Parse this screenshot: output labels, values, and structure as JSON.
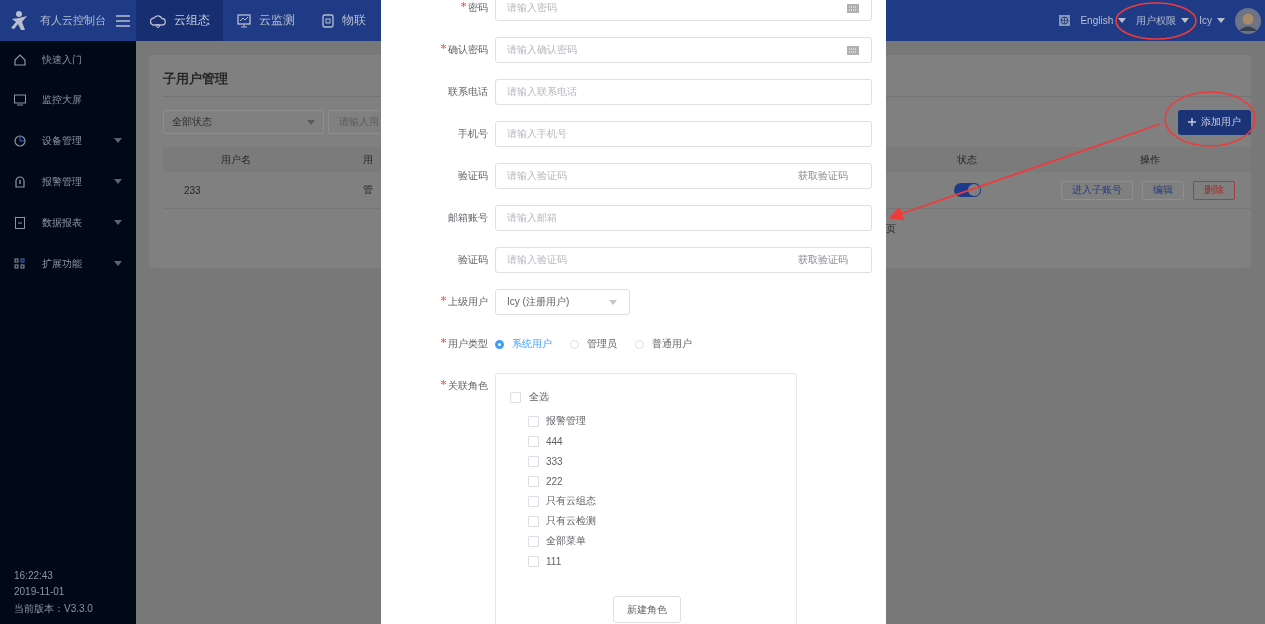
{
  "header": {
    "brand": "有人云控制台",
    "tabs": [
      {
        "label": "云组态",
        "selected": true
      },
      {
        "label": "云监测",
        "selected": false
      },
      {
        "label": "物联",
        "selected": false
      }
    ],
    "language": "English",
    "menu": "用户权限",
    "user": "Icy"
  },
  "sidebar": {
    "items": [
      {
        "label": "快速入门",
        "has_submenu": false
      },
      {
        "label": "监控大屏",
        "has_submenu": false
      },
      {
        "label": "设备管理",
        "has_submenu": true
      },
      {
        "label": "报警管理",
        "has_submenu": true
      },
      {
        "label": "数据报表",
        "has_submenu": true
      },
      {
        "label": "扩展功能",
        "has_submenu": true
      }
    ],
    "footer": [
      "16:22:43",
      "2019-11-01",
      "当前版本：V3.3.0"
    ]
  },
  "page": {
    "title": "子用户管理",
    "status_filter": "全部状态",
    "search": {
      "placeholder": "请输入用"
    },
    "add_button": "添加用户",
    "table": {
      "columns": [
        "用户名",
        "用",
        "状态",
        "操作"
      ],
      "rows": [
        {
          "cells": [
            "233",
            "管"
          ],
          "enabled": true,
          "actions": [
            "进入子账号",
            "编辑",
            "删除"
          ]
        }
      ]
    },
    "pagination_tail": "页"
  },
  "dialog": {
    "fields": [
      {
        "label": "密码",
        "required": true,
        "placeholder": "请输入密码",
        "kind": "password"
      },
      {
        "label": "确认密码",
        "required": true,
        "placeholder": "请输入确认密码",
        "kind": "password"
      },
      {
        "label": "联系电话",
        "required": false,
        "placeholder": "请输入联系电话",
        "kind": "text"
      },
      {
        "label": "手机号",
        "required": false,
        "placeholder": "请输入手机号",
        "kind": "text"
      },
      {
        "label": "验证码",
        "required": false,
        "placeholder": "请输入验证码",
        "kind": "code",
        "action": "获取验证码"
      },
      {
        "label": "邮箱账号",
        "required": false,
        "placeholder": "请输入邮箱",
        "kind": "text"
      },
      {
        "label": "验证码",
        "required": false,
        "placeholder": "请输入验证码",
        "kind": "code",
        "action": "获取验证码"
      }
    ],
    "parent_user": {
      "label": "上级用户",
      "required": true,
      "value": "Icy (注册用户)"
    },
    "user_type": {
      "label": "用户类型",
      "required": true,
      "options": [
        {
          "label": "系统用户",
          "selected": true
        },
        {
          "label": "管理员",
          "selected": false
        },
        {
          "label": "普通用户",
          "selected": false
        }
      ]
    },
    "roles": {
      "label": "关联角色",
      "required": true,
      "select_all": {
        "label": "全选",
        "checked": false
      },
      "items": [
        {
          "label": "报警管理",
          "checked": false
        },
        {
          "label": "444",
          "checked": false
        },
        {
          "label": "333",
          "checked": false
        },
        {
          "label": "222",
          "checked": false
        },
        {
          "label": "只有云组态",
          "checked": false
        },
        {
          "label": "只有云检测",
          "checked": false
        },
        {
          "label": "全部菜单",
          "checked": false
        },
        {
          "label": "111",
          "checked": false
        }
      ],
      "new_button": "新建角色"
    }
  }
}
